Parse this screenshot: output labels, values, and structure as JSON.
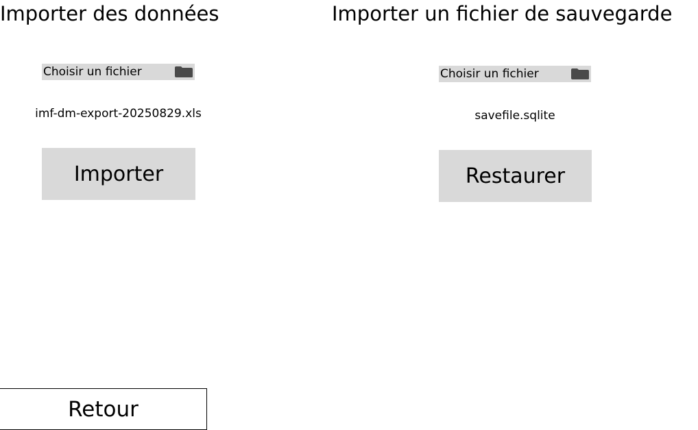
{
  "import_data": {
    "title": "Importer des données",
    "file_picker_label": "Choisir un fichier",
    "selected_file": "imf-dm-export-20250829.xls",
    "button_label": "Importer"
  },
  "import_backup": {
    "title": "Importer un fichier de sauvegarde",
    "file_picker_label": "Choisir un fichier",
    "selected_file": "savefile.sqlite",
    "button_label": "Restaurer"
  },
  "footer": {
    "back_label": "Retour"
  },
  "icons": {
    "file_picker_icon": "folder-icon"
  },
  "colors": {
    "button_background": "#d9d9d9",
    "icon_color": "#4a4a4a"
  }
}
